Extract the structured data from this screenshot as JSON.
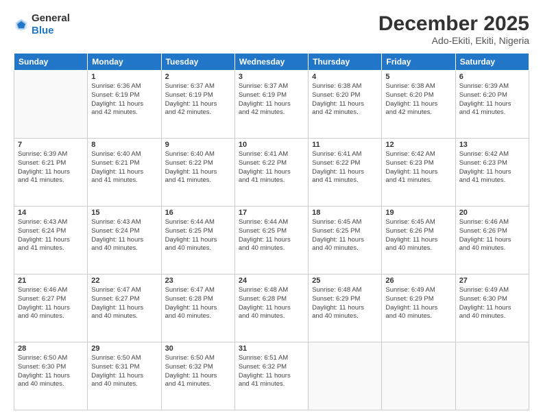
{
  "logo": {
    "general": "General",
    "blue": "Blue"
  },
  "header": {
    "month": "December 2025",
    "location": "Ado-Ekiti, Ekiti, Nigeria"
  },
  "weekdays": [
    "Sunday",
    "Monday",
    "Tuesday",
    "Wednesday",
    "Thursday",
    "Friday",
    "Saturday"
  ],
  "weeks": [
    [
      {
        "day": "",
        "info": ""
      },
      {
        "day": "1",
        "info": "Sunrise: 6:36 AM\nSunset: 6:19 PM\nDaylight: 11 hours\nand 42 minutes."
      },
      {
        "day": "2",
        "info": "Sunrise: 6:37 AM\nSunset: 6:19 PM\nDaylight: 11 hours\nand 42 minutes."
      },
      {
        "day": "3",
        "info": "Sunrise: 6:37 AM\nSunset: 6:19 PM\nDaylight: 11 hours\nand 42 minutes."
      },
      {
        "day": "4",
        "info": "Sunrise: 6:38 AM\nSunset: 6:20 PM\nDaylight: 11 hours\nand 42 minutes."
      },
      {
        "day": "5",
        "info": "Sunrise: 6:38 AM\nSunset: 6:20 PM\nDaylight: 11 hours\nand 42 minutes."
      },
      {
        "day": "6",
        "info": "Sunrise: 6:39 AM\nSunset: 6:20 PM\nDaylight: 11 hours\nand 41 minutes."
      }
    ],
    [
      {
        "day": "7",
        "info": "Sunrise: 6:39 AM\nSunset: 6:21 PM\nDaylight: 11 hours\nand 41 minutes."
      },
      {
        "day": "8",
        "info": "Sunrise: 6:40 AM\nSunset: 6:21 PM\nDaylight: 11 hours\nand 41 minutes."
      },
      {
        "day": "9",
        "info": "Sunrise: 6:40 AM\nSunset: 6:22 PM\nDaylight: 11 hours\nand 41 minutes."
      },
      {
        "day": "10",
        "info": "Sunrise: 6:41 AM\nSunset: 6:22 PM\nDaylight: 11 hours\nand 41 minutes."
      },
      {
        "day": "11",
        "info": "Sunrise: 6:41 AM\nSunset: 6:22 PM\nDaylight: 11 hours\nand 41 minutes."
      },
      {
        "day": "12",
        "info": "Sunrise: 6:42 AM\nSunset: 6:23 PM\nDaylight: 11 hours\nand 41 minutes."
      },
      {
        "day": "13",
        "info": "Sunrise: 6:42 AM\nSunset: 6:23 PM\nDaylight: 11 hours\nand 41 minutes."
      }
    ],
    [
      {
        "day": "14",
        "info": "Sunrise: 6:43 AM\nSunset: 6:24 PM\nDaylight: 11 hours\nand 41 minutes."
      },
      {
        "day": "15",
        "info": "Sunrise: 6:43 AM\nSunset: 6:24 PM\nDaylight: 11 hours\nand 40 minutes."
      },
      {
        "day": "16",
        "info": "Sunrise: 6:44 AM\nSunset: 6:25 PM\nDaylight: 11 hours\nand 40 minutes."
      },
      {
        "day": "17",
        "info": "Sunrise: 6:44 AM\nSunset: 6:25 PM\nDaylight: 11 hours\nand 40 minutes."
      },
      {
        "day": "18",
        "info": "Sunrise: 6:45 AM\nSunset: 6:25 PM\nDaylight: 11 hours\nand 40 minutes."
      },
      {
        "day": "19",
        "info": "Sunrise: 6:45 AM\nSunset: 6:26 PM\nDaylight: 11 hours\nand 40 minutes."
      },
      {
        "day": "20",
        "info": "Sunrise: 6:46 AM\nSunset: 6:26 PM\nDaylight: 11 hours\nand 40 minutes."
      }
    ],
    [
      {
        "day": "21",
        "info": "Sunrise: 6:46 AM\nSunset: 6:27 PM\nDaylight: 11 hours\nand 40 minutes."
      },
      {
        "day": "22",
        "info": "Sunrise: 6:47 AM\nSunset: 6:27 PM\nDaylight: 11 hours\nand 40 minutes."
      },
      {
        "day": "23",
        "info": "Sunrise: 6:47 AM\nSunset: 6:28 PM\nDaylight: 11 hours\nand 40 minutes."
      },
      {
        "day": "24",
        "info": "Sunrise: 6:48 AM\nSunset: 6:28 PM\nDaylight: 11 hours\nand 40 minutes."
      },
      {
        "day": "25",
        "info": "Sunrise: 6:48 AM\nSunset: 6:29 PM\nDaylight: 11 hours\nand 40 minutes."
      },
      {
        "day": "26",
        "info": "Sunrise: 6:49 AM\nSunset: 6:29 PM\nDaylight: 11 hours\nand 40 minutes."
      },
      {
        "day": "27",
        "info": "Sunrise: 6:49 AM\nSunset: 6:30 PM\nDaylight: 11 hours\nand 40 minutes."
      }
    ],
    [
      {
        "day": "28",
        "info": "Sunrise: 6:50 AM\nSunset: 6:30 PM\nDaylight: 11 hours\nand 40 minutes."
      },
      {
        "day": "29",
        "info": "Sunrise: 6:50 AM\nSunset: 6:31 PM\nDaylight: 11 hours\nand 40 minutes."
      },
      {
        "day": "30",
        "info": "Sunrise: 6:50 AM\nSunset: 6:32 PM\nDaylight: 11 hours\nand 41 minutes."
      },
      {
        "day": "31",
        "info": "Sunrise: 6:51 AM\nSunset: 6:32 PM\nDaylight: 11 hours\nand 41 minutes."
      },
      {
        "day": "",
        "info": ""
      },
      {
        "day": "",
        "info": ""
      },
      {
        "day": "",
        "info": ""
      }
    ]
  ]
}
